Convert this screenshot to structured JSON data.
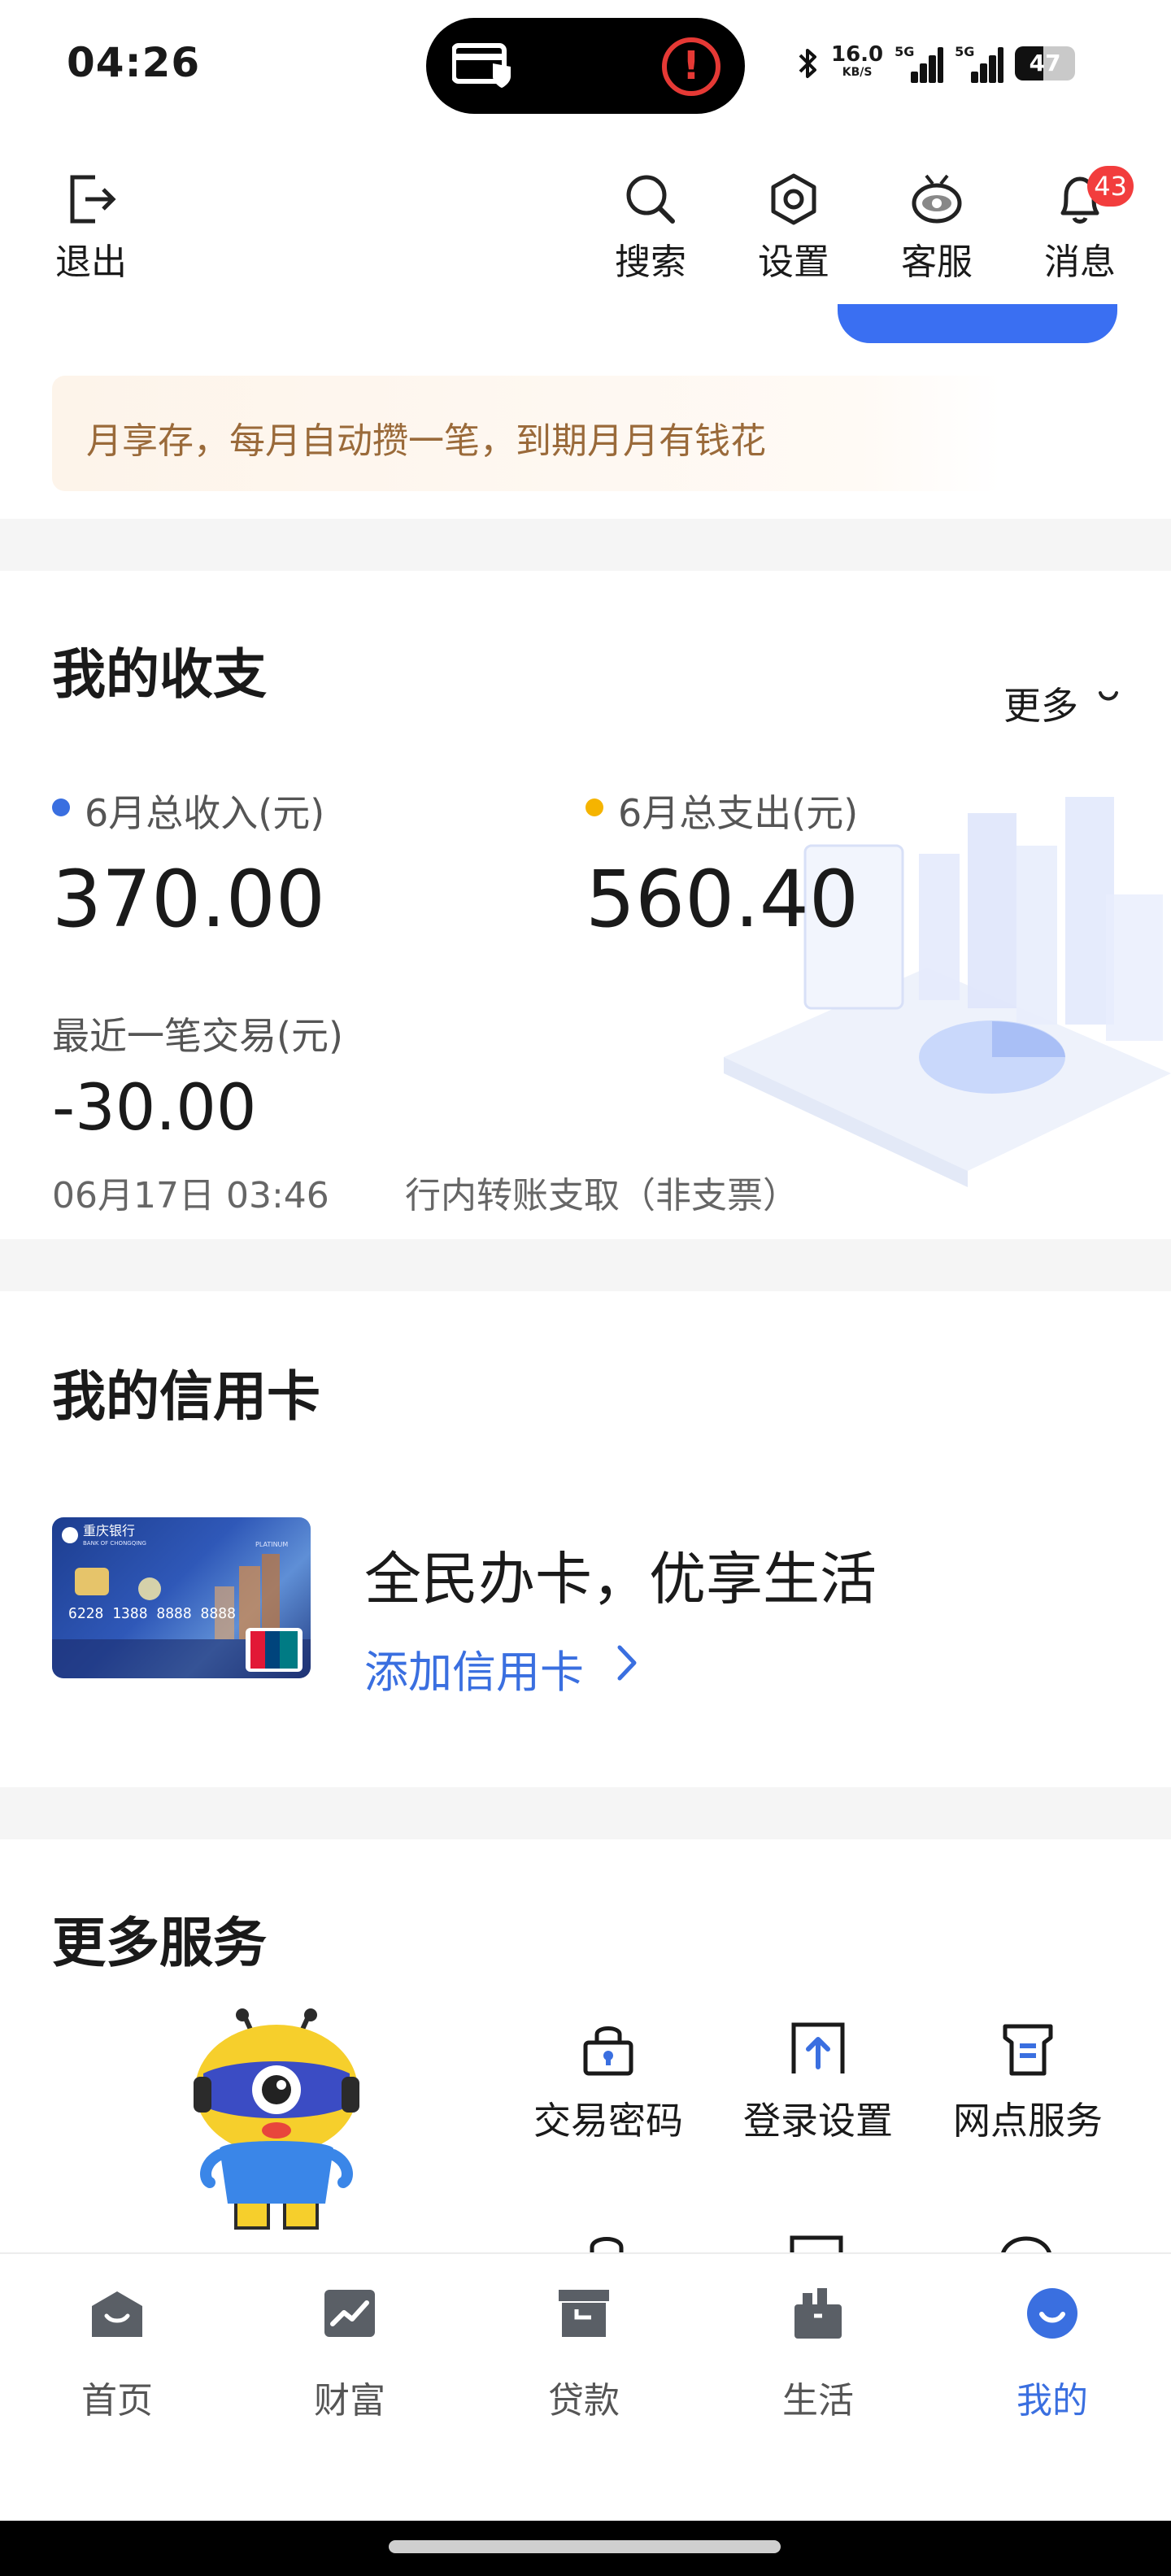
{
  "status_bar": {
    "time": "04:26",
    "net_speed": "16.0",
    "net_unit": "KB/S",
    "sim1": "5G",
    "sim2": "5G",
    "battery": "47",
    "battery_level": 0.47
  },
  "header": {
    "exit_label": "退出",
    "search_label": "搜索",
    "settings_label": "设置",
    "service_label": "客服",
    "messages_label": "消息",
    "message_badge": "43"
  },
  "promo": {
    "text": "月享存，每月自动攒一笔，到期月月有钱花"
  },
  "income": {
    "title": "我的收支",
    "more": "更多",
    "income_label": "6月总收入(元)",
    "income_value": "370.00",
    "expense_label": "6月总支出(元)",
    "expense_value": "560.40",
    "recent_label": "最近一笔交易(元)",
    "recent_amount": "-30.00",
    "recent_date": "06月17日 03:46",
    "recent_desc": "行内转账支取（非支票）",
    "income_dot_color": "#3a6fe0",
    "expense_dot_color": "#f5b400"
  },
  "credit_card": {
    "title": "我的信用卡",
    "headline": "全民办卡，优享生活",
    "add_link": "添加信用卡",
    "card_bank": "重庆银行",
    "card_bank_en": "BANK OF CHONGQING",
    "card_tier": "PLATINUM",
    "card_number": "6228 1388 8888 8888",
    "card_network": "UnionPay 银联"
  },
  "services": {
    "title": "更多服务",
    "items": [
      {
        "label": "交易密码",
        "icon": "lock-icon"
      },
      {
        "label": "登录设置",
        "icon": "login-upload-icon"
      },
      {
        "label": "网点服务",
        "icon": "branch-icon"
      }
    ]
  },
  "bottom_nav": {
    "items": [
      {
        "label": "首页",
        "icon": "home-icon"
      },
      {
        "label": "财富",
        "icon": "wealth-chart-icon"
      },
      {
        "label": "贷款",
        "icon": "loan-box-icon"
      },
      {
        "label": "生活",
        "icon": "life-bag-icon"
      },
      {
        "label": "我的",
        "icon": "profile-icon"
      }
    ],
    "active_color": "#3a6fe0"
  }
}
